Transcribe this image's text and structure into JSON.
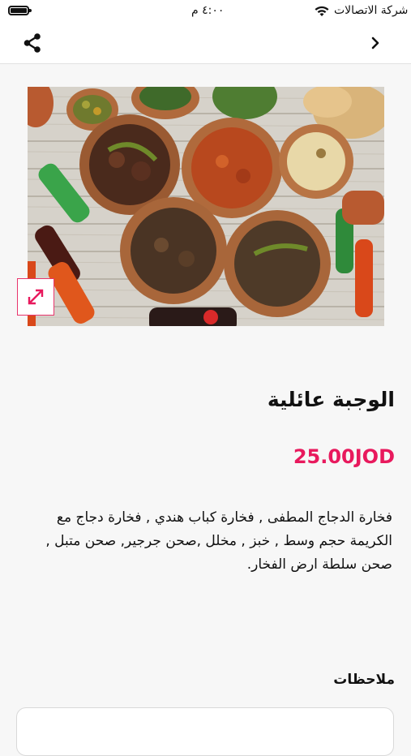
{
  "status_bar": {
    "time": "٤:٠٠ م",
    "carrier": "شركة الاتصالات"
  },
  "nav": {
    "share_icon": "share-icon",
    "back_icon": "chevron-right-icon"
  },
  "product": {
    "image_alt_icon": "food-photo",
    "expand_icon": "expand-icon",
    "title": "الوجبة عائلية",
    "price": "25.00JOD",
    "description": "فخارة الدجاج المطفى , فخارة كباب هندي , فخارة دجاج مع الكريمة حجم وسط , خبز , مخلل ,صحن جرجير, صحن متبل , صحن سلطة ارض الفخار."
  },
  "notes": {
    "label": "ملاحظات",
    "value": ""
  },
  "colors": {
    "accent": "#e8195d",
    "background": "#f7f7f7"
  }
}
